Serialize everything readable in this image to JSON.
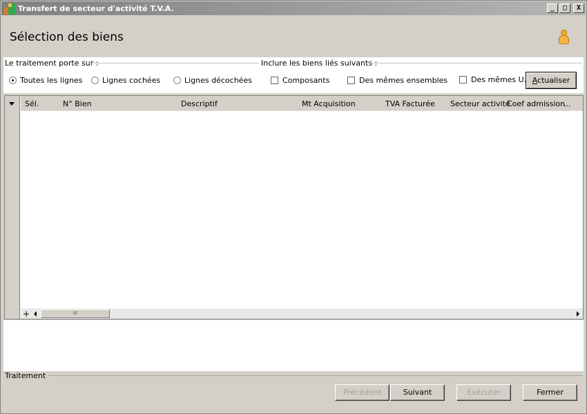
{
  "window": {
    "title": "Transfert de secteur d'activité T.V.A.",
    "controls": {
      "minimize": "_",
      "maximize": "□",
      "close": "X"
    }
  },
  "header": {
    "title": "Sélection des biens",
    "user_icon": "user-icon"
  },
  "options": {
    "treatment_label": "Le traitement porte sur :",
    "include_label": "Inclure les biens liés suivants :",
    "radios": [
      {
        "label": "Toutes les lignes",
        "checked": true
      },
      {
        "label": "Lignes cochées",
        "checked": false
      },
      {
        "label": "Lignes décochées",
        "checked": false
      }
    ],
    "checkboxes": [
      {
        "label": "Composants",
        "checked": false
      },
      {
        "label": "Des mêmes ensembles",
        "checked": false
      },
      {
        "label": "Des mêmes U.",
        "checked": false
      }
    ],
    "refresh_button": {
      "label_first": "A",
      "label_rest": "ctualiser"
    }
  },
  "grid": {
    "columns": [
      "Sél.",
      "N° Bien",
      "Descriptif",
      "Mt Acquisition",
      "TVA Facturée",
      "Secteur activité",
      "Coef admission",
      "..."
    ],
    "rows": [],
    "scroll_plus": "+",
    "scroll_thumb": "III"
  },
  "footer": {
    "label": "Traitement",
    "buttons": {
      "previous": "Précédent",
      "next": "Suivant",
      "execute": "Exécuter",
      "close": "Fermer"
    }
  }
}
